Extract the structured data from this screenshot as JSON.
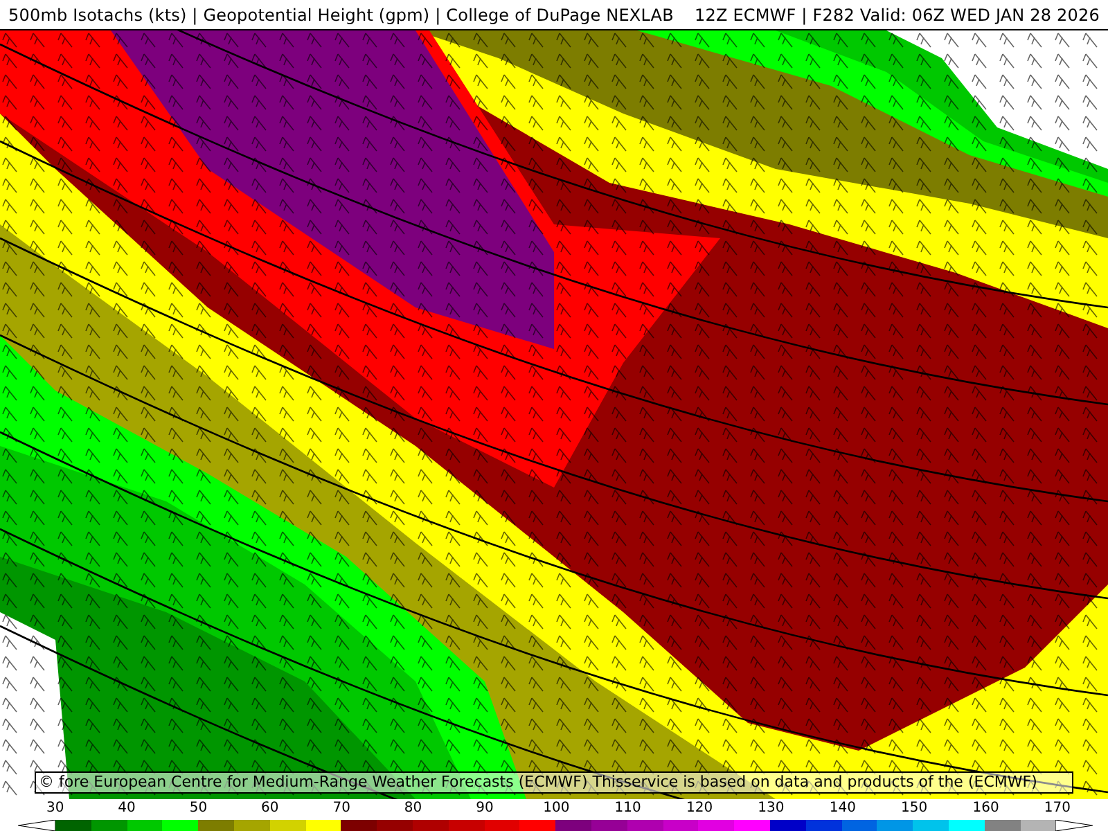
{
  "header": {
    "title": "500mb Isotachs (kts) | Geopotential Height (gpm) | College of DuPage NEXLAB",
    "run": "12Z ECMWF | F282 Valid: 06Z WED JAN 28 2026"
  },
  "attribution": "© fore European Centre for Medium-Range Weather Forecasts (ECMWF)  Thisservice is based on data and products of the (ECMWF)",
  "legend": {
    "ticks": [
      "30",
      "40",
      "50",
      "60",
      "70",
      "80",
      "90",
      "100",
      "110",
      "120",
      "130",
      "140",
      "150",
      "160",
      "170"
    ],
    "bins": [
      {
        "color": "#006400"
      },
      {
        "color": "#009600"
      },
      {
        "color": "#00c800"
      },
      {
        "color": "#00ff00"
      },
      {
        "color": "#7d7d00"
      },
      {
        "color": "#a5a500"
      },
      {
        "color": "#d2d200"
      },
      {
        "color": "#ffff00"
      },
      {
        "color": "#7d0000"
      },
      {
        "color": "#960000"
      },
      {
        "color": "#af0000"
      },
      {
        "color": "#c80000"
      },
      {
        "color": "#e10000"
      },
      {
        "color": "#ff0000"
      },
      {
        "color": "#7d007d"
      },
      {
        "color": "#960096"
      },
      {
        "color": "#af00af"
      },
      {
        "color": "#c800c8"
      },
      {
        "color": "#e100e1"
      },
      {
        "color": "#ff00ff"
      },
      {
        "color": "#0000c8"
      },
      {
        "color": "#0032dc"
      },
      {
        "color": "#0064e1"
      },
      {
        "color": "#0096e6"
      },
      {
        "color": "#00c3eb"
      },
      {
        "color": "#00ffff"
      },
      {
        "color": "#828282"
      },
      {
        "color": "#b4b4b4"
      }
    ]
  }
}
